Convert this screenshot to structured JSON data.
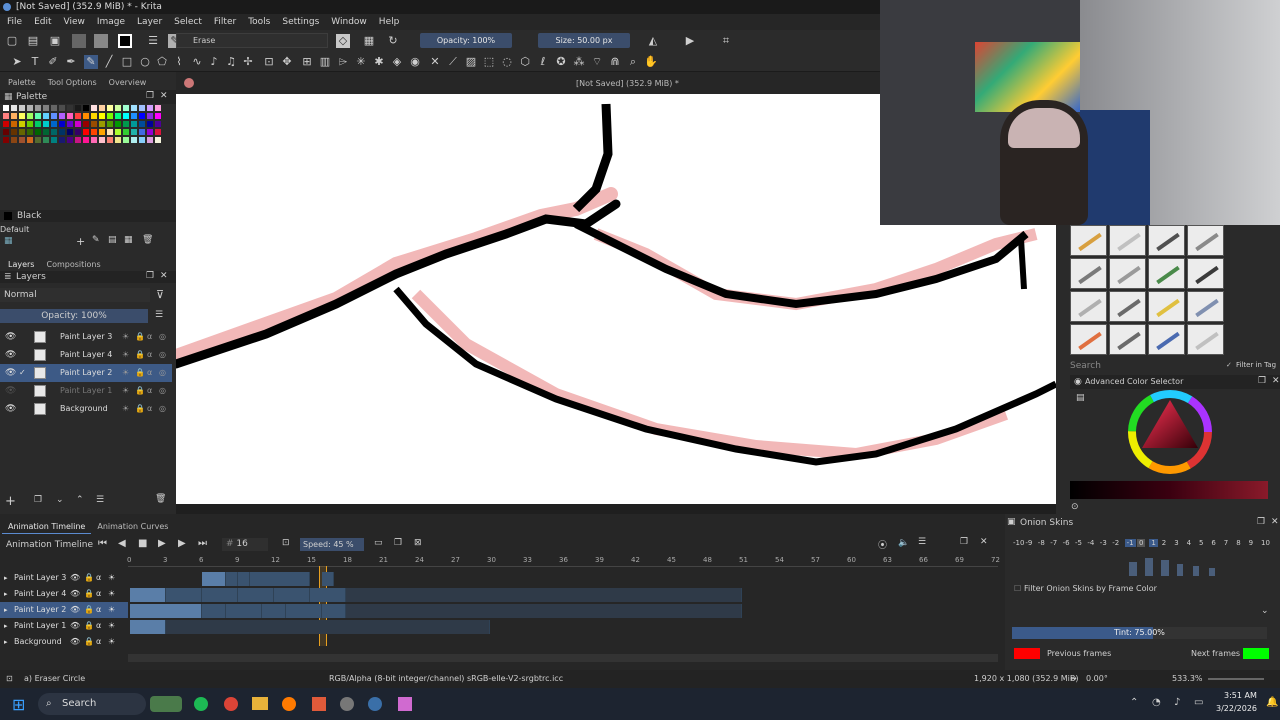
{
  "window": {
    "title": "[Not Saved]  (352.9 MiB) * - Krita"
  },
  "menu": [
    "File",
    "Edit",
    "View",
    "Image",
    "Layer",
    "Select",
    "Filter",
    "Tools",
    "Settings",
    "Window",
    "Help"
  ],
  "toolbar": {
    "brush_preset": "Erase",
    "opacity": "Opacity: 100%",
    "size": "Size: 50.00 px"
  },
  "docker_tabs": [
    "Palette",
    "Tool Options",
    "Overview"
  ],
  "palette": {
    "title": "Palette",
    "color_name": "Black",
    "palette_name": "Default",
    "colors": [
      "#ffffff",
      "#e6e6e6",
      "#cccccc",
      "#b3b3b3",
      "#999999",
      "#808080",
      "#666666",
      "#4d4d4d",
      "#333333",
      "#1a1a1a",
      "#000000",
      "#ffe0e0",
      "#ffd0a0",
      "#ffffa0",
      "#d0ffa0",
      "#a0ffd0",
      "#a0e0ff",
      "#a0c0ff",
      "#d0a0ff",
      "#ffa0e0",
      "#ff8080",
      "#ffb060",
      "#ffff60",
      "#a0ff60",
      "#60ffb0",
      "#60d0ff",
      "#6090ff",
      "#b060ff",
      "#ff60c0",
      "#ff4040",
      "#ff8c00",
      "#ffd700",
      "#ffff00",
      "#7cfc00",
      "#00ff7f",
      "#00ffff",
      "#1e90ff",
      "#0000ff",
      "#8a2be2",
      "#ff00ff",
      "#cc0000",
      "#cc6600",
      "#cccc00",
      "#66cc00",
      "#00cc66",
      "#00cccc",
      "#0066cc",
      "#0000cc",
      "#6600cc",
      "#cc00cc",
      "#990000",
      "#994c00",
      "#999900",
      "#4c9900",
      "#009900",
      "#00994c",
      "#009999",
      "#004c99",
      "#000099",
      "#4c0099",
      "#660000",
      "#663300",
      "#666600",
      "#336600",
      "#006600",
      "#006633",
      "#006666",
      "#003366",
      "#000066",
      "#330066",
      "#ff0000",
      "#ff4500",
      "#ffa500",
      "#ffe4b5",
      "#adff2f",
      "#32cd32",
      "#20b2aa",
      "#4169e1",
      "#9400d3",
      "#dc143c",
      "#800000",
      "#8b4513",
      "#a0522d",
      "#d2691e",
      "#556b2f",
      "#2e8b57",
      "#008080",
      "#191970",
      "#4b0082",
      "#c71585",
      "#ff1493",
      "#ff69b4",
      "#ffc0cb",
      "#fa8072",
      "#f0e68c",
      "#98fb98",
      "#afeeee",
      "#87cefa",
      "#dda0dd",
      "#f5f5dc"
    ]
  },
  "layers_panel": {
    "tabs": [
      "Layers",
      "Compositions"
    ],
    "blend_mode": "Normal",
    "opacity": "Opacity:  100%",
    "layers": [
      {
        "name": "Paint Layer 3",
        "selected": false,
        "dim": false
      },
      {
        "name": "Paint Layer 4",
        "selected": false,
        "dim": false
      },
      {
        "name": "Paint Layer 2",
        "selected": true,
        "dim": false
      },
      {
        "name": "Paint Layer 1",
        "selected": false,
        "dim": true
      },
      {
        "name": "Background",
        "selected": false,
        "dim": false
      }
    ]
  },
  "canvas": {
    "header": "[Not Saved]  (352.9 MiB) *"
  },
  "brushes": {
    "search_placeholder": "Search",
    "filter_label": "Filter in Tag"
  },
  "color_selector": {
    "title": "Advanced Color Selector"
  },
  "timeline": {
    "tabs": [
      "Animation Timeline",
      "Animation Curves"
    ],
    "title": "Animation Timeline",
    "frame": "16",
    "speed": "Speed: 45 %",
    "ticks": [
      "0",
      "3",
      "6",
      "9",
      "12",
      "15",
      "18",
      "21",
      "24",
      "27",
      "30",
      "33",
      "36",
      "39",
      "42",
      "45",
      "48",
      "51",
      "54",
      "57",
      "60",
      "63",
      "66",
      "69",
      "72"
    ],
    "rows": [
      {
        "name": "Paint Layer 3",
        "selected": false
      },
      {
        "name": "Paint Layer 4",
        "selected": false
      },
      {
        "name": "Paint Layer 2",
        "selected": true
      },
      {
        "name": "Paint Layer 1",
        "selected": false
      },
      {
        "name": "Background",
        "selected": false
      }
    ]
  },
  "onion": {
    "title": "Onion Skins",
    "numbers": [
      "-10",
      "-9",
      "-8",
      "-7",
      "-6",
      "-5",
      "-4",
      "-3",
      "-2",
      "-1",
      "0",
      "1",
      "2",
      "3",
      "4",
      "5",
      "6",
      "7",
      "8",
      "9",
      "10"
    ],
    "filter_label": "Filter Onion Skins by Frame Color",
    "tint": "Tint: 75.00%",
    "tint_value": 0.75,
    "previous_label": "Previous frames",
    "next_label": "Next frames",
    "previous_color": "#ff0000",
    "next_color": "#00ff00"
  },
  "status": {
    "tool": "a) Eraser Circle",
    "color_profile": "RGB/Alpha (8-bit integer/channel)  sRGB-elle-V2-srgbtrc.icc",
    "dimensions": "1,920 x 1,080 (352.9 MiB)",
    "rotation": "0.00°",
    "zoom": "533.3%"
  },
  "taskbar": {
    "search": "Search",
    "time": "3:51 AM",
    "date": "3/22/2026"
  }
}
